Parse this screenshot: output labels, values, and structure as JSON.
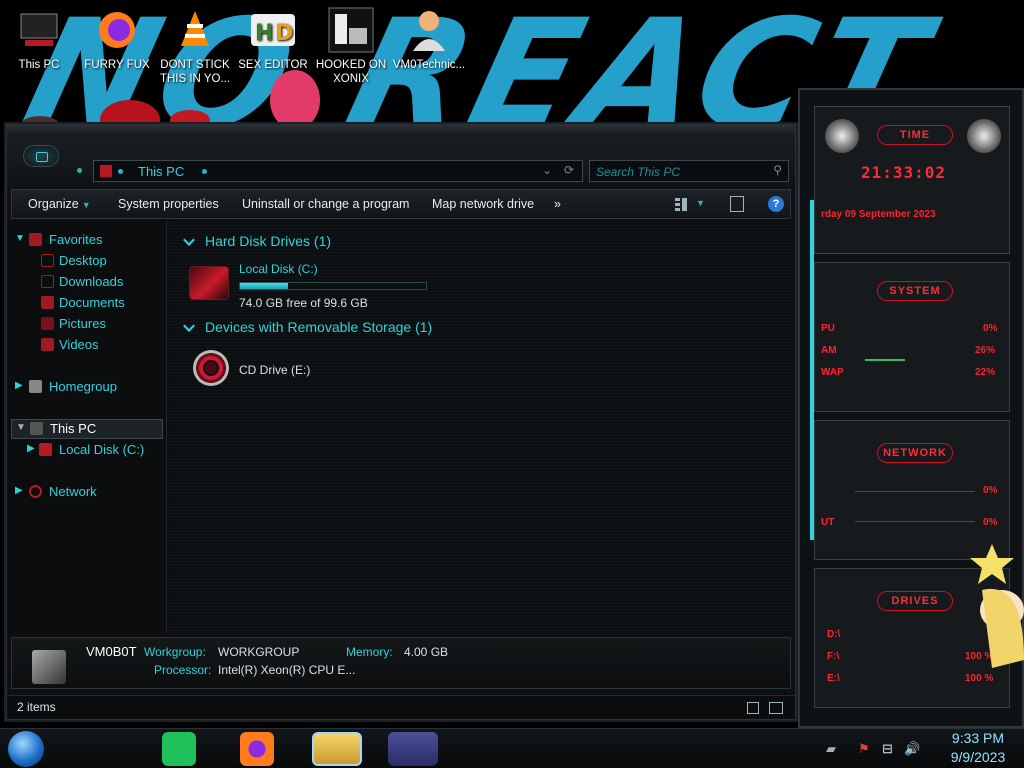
{
  "desktop": {
    "wallpaper_word": "NO REACT",
    "icons": [
      {
        "name": "this-pc",
        "label": "This PC"
      },
      {
        "name": "firefox",
        "label": "FURRY FUX"
      },
      {
        "name": "vlc",
        "label": "DONT STICK THIS IN YO..."
      },
      {
        "name": "hxd",
        "label": "SEX EDITOR"
      },
      {
        "name": "game",
        "label": "HOOKED ON XONIX"
      },
      {
        "name": "user",
        "label": "VM0Technic..."
      }
    ]
  },
  "explorer": {
    "address": {
      "path": "This PC"
    },
    "search": {
      "placeholder": "Search This PC"
    },
    "toolbar": {
      "organize": "Organize",
      "system_properties": "System properties",
      "uninstall": "Uninstall or change a program",
      "map_drive": "Map network drive",
      "more": "»",
      "help": "?"
    },
    "nav": {
      "favorites": "Favorites",
      "desktop": "Desktop",
      "downloads": "Downloads",
      "documents": "Documents",
      "pictures": "Pictures",
      "videos": "Videos",
      "homegroup": "Homegroup",
      "this_pc": "This PC",
      "local_disk": "Local Disk (C:)",
      "network": "Network"
    },
    "groups": {
      "hdd": "Hard Disk Drives (1)",
      "removable": "Devices with Removable Storage (1)"
    },
    "drives": {
      "c_name": "Local Disk (C:)",
      "c_free": "74.0 GB free of 99.6 GB",
      "c_used_fraction": 0.257,
      "e_name": "CD Drive (E:)"
    },
    "details": {
      "computer": "VM0B0T",
      "workgroup_label": "Workgroup:",
      "workgroup": "WORKGROUP",
      "memory_label": "Memory:",
      "memory": "4.00 GB",
      "processor_label": "Processor:",
      "processor": "Intel(R) Xeon(R) CPU E..."
    },
    "status": {
      "items": "2 items"
    }
  },
  "gadget": {
    "time_title": "TIME",
    "time": "21:33:02",
    "date": "rday 09 September 2023",
    "system_title": "SYSTEM",
    "cpu_label": "PU",
    "cpu": "0%",
    "ram_label": "AM",
    "ram": "26%",
    "swap_label": "WAP",
    "swap": "22%",
    "network_title": "NETWORK",
    "net_in": "0%",
    "net_out_label": "UT",
    "net_out": "0%",
    "drives_title": "DRIVES",
    "drive_d": "D:\\",
    "drive_f": "F:\\",
    "drive_e": "E:\\",
    "drive_f_pct": "100 %",
    "drive_e_pct": "100 %"
  },
  "taskbar": {
    "time": "9:33 PM",
    "date": "9/9/2023"
  }
}
